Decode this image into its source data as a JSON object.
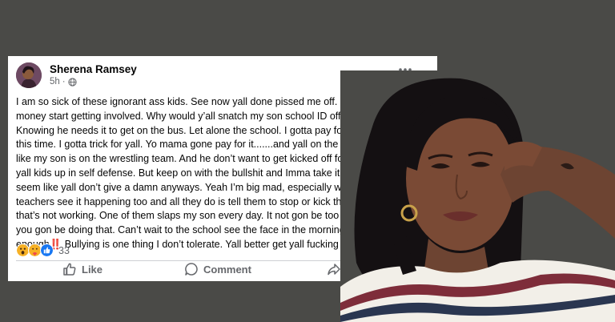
{
  "post": {
    "author": "Sherena Ramsey",
    "time": "5h",
    "lines": [
      "I am so sick of these ignorant ass kids. See now yall done pissed me off. Especially when",
      "money start getting involved. Why would y’all snatch my son school ID off him and",
      "Knowing he needs it to get on the bus. Let alone the school. I gotta pay for that......",
      "this time. I gotta trick for yall. Yo mama gone pay for it.......and yall on the football",
      "like my son is on the wrestling team. And he don’t want to get kicked off for fuck",
      "yall kids up in self defense. But keep on with the bullshit and Imma take it that fa",
      "seem like yall don’t give a damn anyways. Yeah I’m big mad, especially when son",
      "teachers see it happening too and all they do is tell them to stop or kick them o",
      "that’s not working. One of them slaps my son every day. It not gon be too many",
      "you gon be doing that. Can’t wait to the school see the face in the morning. Eno",
      "enough‼️ Bullying is one thing I don’t tolerate. Yall better get yall fucking kids."
    ],
    "reaction_count": "33",
    "actions": {
      "like": "Like",
      "comment": "Comment"
    }
  },
  "icons": [
    "avatar",
    "globe-icon",
    "more-icon",
    "wow-reaction-icon",
    "care-reaction-icon",
    "like-reaction-icon",
    "like-icon",
    "comment-icon",
    "share-icon"
  ],
  "colors": {
    "background": "#4a4a47",
    "card": "#ffffff",
    "secondary_text": "#65676b",
    "like_blue": "#1877f2"
  }
}
